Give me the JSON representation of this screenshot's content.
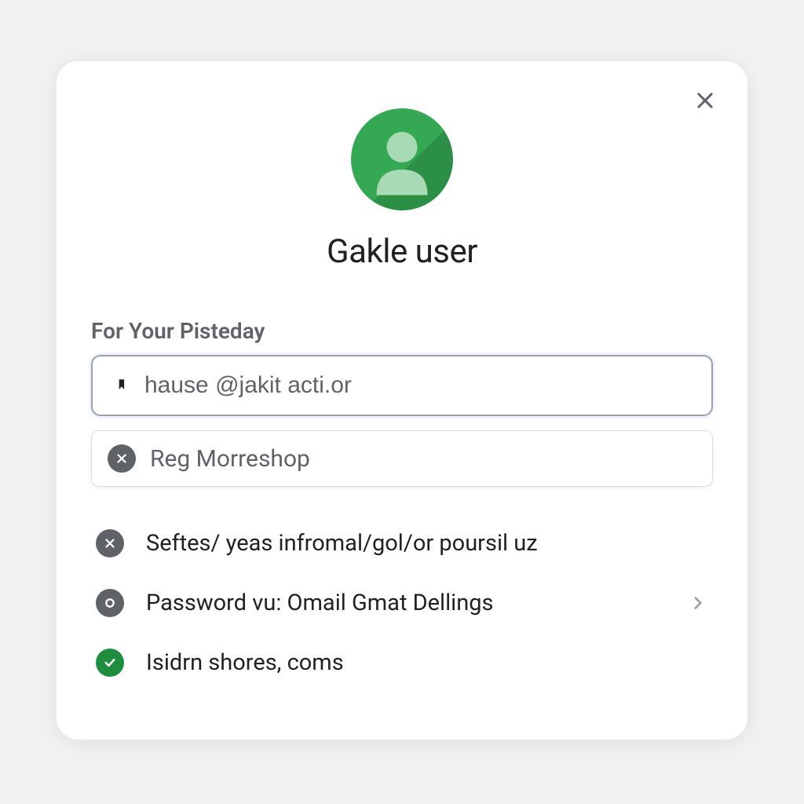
{
  "title": "Gakle user",
  "section_label": "For Your Pisteday",
  "input": {
    "value": "hause @jakit acti.or"
  },
  "chip": {
    "text": "Reg Morreshop"
  },
  "list": [
    {
      "icon": "x",
      "text": "Seftes/ yeas infromal/gol/or poursil uz",
      "chevron": false
    },
    {
      "icon": "o",
      "text": "Password vu: Omail Gmat Dellings",
      "chevron": true
    },
    {
      "icon": "check",
      "text": "Isidrn shores, coms",
      "chevron": false
    }
  ]
}
